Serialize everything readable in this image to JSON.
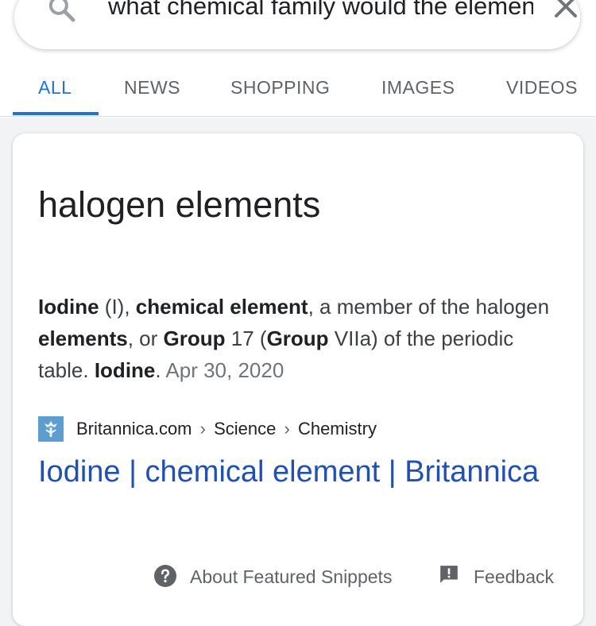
{
  "search": {
    "query": "what chemical family would the element iodine belong to"
  },
  "tabs": [
    {
      "label": "ALL",
      "active": true
    },
    {
      "label": "NEWS"
    },
    {
      "label": "SHOPPING"
    },
    {
      "label": "IMAGES"
    },
    {
      "label": "VIDEOS"
    }
  ],
  "featured_snippet": {
    "answer_title": "halogen elements",
    "snippet_parts": [
      {
        "text": "Iodine",
        "bold": true
      },
      {
        "text": " (I), "
      },
      {
        "text": "chemical element",
        "bold": true
      },
      {
        "text": ", a member of the halogen "
      },
      {
        "text": "elements",
        "bold": true
      },
      {
        "text": ", or "
      },
      {
        "text": "Group",
        "bold": true
      },
      {
        "text": " 17 ("
      },
      {
        "text": "Group",
        "bold": true
      },
      {
        "text": " VIIa) of the periodic table. "
      },
      {
        "text": "Iodine",
        "bold": true
      },
      {
        "text": ". "
      }
    ],
    "date": "Apr 30, 2020",
    "source": {
      "site": "Britannica.com",
      "separator": "›",
      "path": [
        "Science",
        "Chemistry"
      ],
      "favicon": "britannica-thistle-icon"
    },
    "link_title": "Iodine | chemical element | Britannica"
  },
  "footer": {
    "about_label": "About Featured Snippets",
    "about_icon": "help-circle-icon",
    "feedback_label": "Feedback",
    "feedback_icon": "feedback-icon"
  },
  "colors": {
    "accent": "#1a73e8",
    "link": "#1f4fbf",
    "text": "#202124",
    "muted": "#5f6368"
  }
}
